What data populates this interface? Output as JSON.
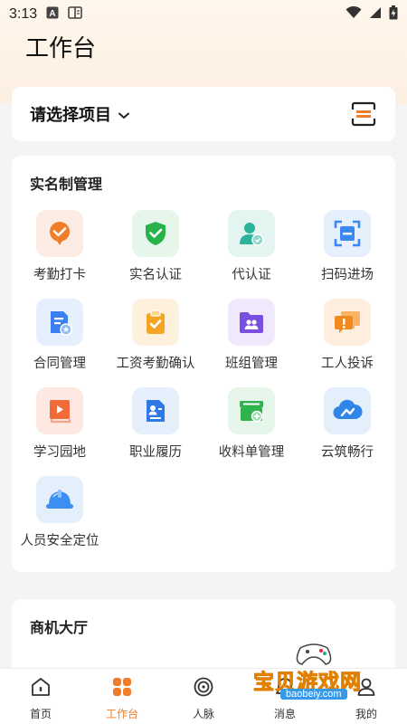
{
  "status_bar": {
    "time": "3:13",
    "icons": [
      "a-notification-icon",
      "book-notification-icon",
      "wifi-icon",
      "signal-icon",
      "battery-charging-icon"
    ]
  },
  "header": {
    "title": "工作台"
  },
  "project_selector": {
    "label": "请选择项目",
    "dropdown_icon": "chevron-down-icon",
    "scan_icon": "scan-icon"
  },
  "realname": {
    "title": "实名制管理",
    "items": [
      {
        "label": "考勤打卡",
        "icon": "attendance-check-icon",
        "bg": "#fdece3",
        "color": "#f07d2a"
      },
      {
        "label": "实名认证",
        "icon": "shield-check-icon",
        "bg": "#e7f6ea",
        "color": "#27b24a"
      },
      {
        "label": "代认证",
        "icon": "user-verify-icon",
        "bg": "#e4f4f1",
        "color": "#2bb39b"
      },
      {
        "label": "扫码进场",
        "icon": "scan-code-icon",
        "bg": "#e6f0fc",
        "color": "#3b88f0"
      },
      {
        "label": "合同管理",
        "icon": "contract-icon",
        "bg": "#e6f0fc",
        "color": "#3b7ff0"
      },
      {
        "label": "工资考勤确认",
        "icon": "clipboard-check-icon",
        "bg": "#fdf0dd",
        "color": "#f5a524"
      },
      {
        "label": "班组管理",
        "icon": "team-folder-icon",
        "bg": "#efe9fb",
        "color": "#7a4fe0"
      },
      {
        "label": "工人投诉",
        "icon": "complaint-chat-icon",
        "bg": "#fdeee0",
        "color": "#f08a1e"
      },
      {
        "label": "学习园地",
        "icon": "video-book-icon",
        "bg": "#fde9e2",
        "color": "#f06a3a"
      },
      {
        "label": "职业履历",
        "icon": "resume-icon",
        "bg": "#e6effc",
        "color": "#2f78e8"
      },
      {
        "label": "收料单管理",
        "icon": "receipt-box-icon",
        "bg": "#e7f6ea",
        "color": "#2fb34f"
      },
      {
        "label": "云筑畅行",
        "icon": "cloud-icon",
        "bg": "#e4effc",
        "color": "#2f86e8"
      },
      {
        "label": "人员安全定位",
        "icon": "helmet-icon",
        "bg": "#e4effc",
        "color": "#3a8ff0"
      }
    ]
  },
  "business": {
    "title": "商机大厅"
  },
  "tabbar": {
    "tabs": [
      {
        "label": "首页",
        "icon": "home-icon",
        "active": false
      },
      {
        "label": "工作台",
        "icon": "grid-apps-icon",
        "active": true
      },
      {
        "label": "人脉",
        "icon": "contacts-icon",
        "active": false
      },
      {
        "label": "消息",
        "icon": "message-icon",
        "active": false
      },
      {
        "label": "我的",
        "icon": "profile-icon",
        "active": false
      }
    ]
  },
  "watermark": {
    "text": "宝贝游戏网",
    "url": "baobeiy.com"
  },
  "colors": {
    "accent": "#f07d2a",
    "header_bg": "#fdf0e2",
    "page_bg": "#f4f4f4"
  }
}
